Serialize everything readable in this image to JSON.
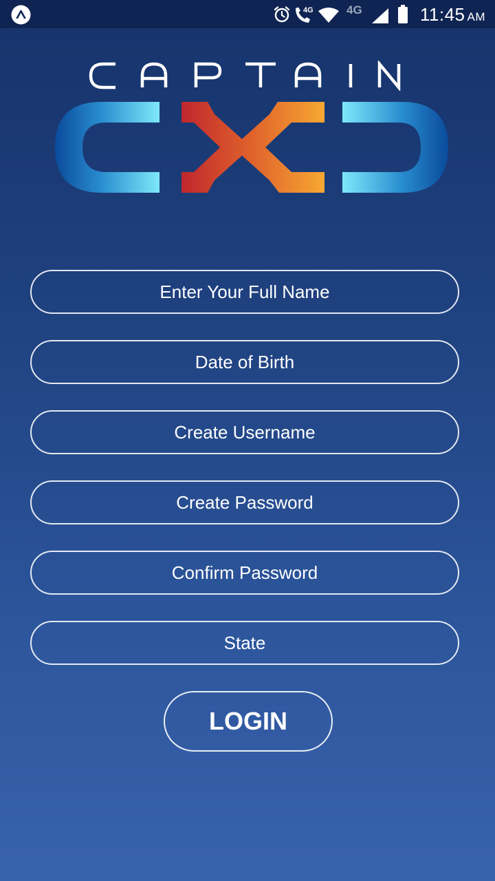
{
  "status_bar": {
    "time": "11:45",
    "ampm": "AM",
    "network_label_1": "4G",
    "network_label_2": "4G",
    "icons": [
      "app-badge-icon",
      "alarm-icon",
      "volte-call-icon",
      "wifi-icon",
      "cell-signal-icon",
      "battery-icon"
    ]
  },
  "logo": {
    "wordmark": "CAPTAIN",
    "mark": "CXD",
    "colors": {
      "blue_dark": "#0a4a9c",
      "blue_light": "#7ee8fa",
      "red": "#c0272d",
      "orange": "#f7a833"
    }
  },
  "form": {
    "full_name_placeholder": "Enter Your Full Name",
    "dob_placeholder": "Date of Birth",
    "username_placeholder": "Create Username",
    "password_placeholder": "Create Password",
    "confirm_password_placeholder": "Confirm Password",
    "state_placeholder": "State",
    "login_label": "LOGIN"
  },
  "colors": {
    "background_top": "#16336b",
    "background_bottom": "#3962ad",
    "status_bar": "#0f2452",
    "text": "#ffffff"
  }
}
